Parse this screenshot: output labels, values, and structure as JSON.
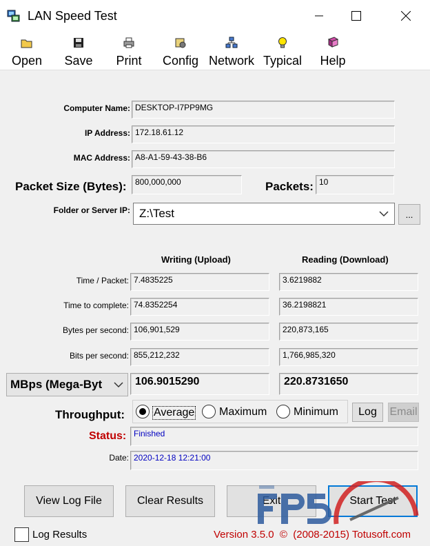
{
  "window": {
    "title": "LAN Speed Test"
  },
  "toolbar": [
    {
      "label": "Open",
      "icon": "open-folder-icon"
    },
    {
      "label": "Save",
      "icon": "floppy-disk-icon"
    },
    {
      "label": "Print",
      "icon": "printer-icon"
    },
    {
      "label": "Config",
      "icon": "config-icon"
    },
    {
      "label": "Network",
      "icon": "network-icon"
    },
    {
      "label": "Typical",
      "icon": "lightbulb-icon"
    },
    {
      "label": "Help",
      "icon": "help-book-icon"
    }
  ],
  "info": {
    "computer_name_label": "Computer Name:",
    "computer_name": "DESKTOP-I7PP9MG",
    "ip_label": "IP Address:",
    "ip": "172.18.61.12",
    "mac_label": "MAC Address:",
    "mac": "A8-A1-59-43-38-B6",
    "packet_size_label": "Packet Size (Bytes):",
    "packet_size": "800,000,000",
    "packets_label": "Packets:",
    "packets": "10",
    "folder_label": "Folder or Server IP:",
    "folder": "Z:\\Test",
    "browse_label": "..."
  },
  "results": {
    "writing_header": "Writing (Upload)",
    "reading_header": "Reading (Download)",
    "time_packet_label": "Time / Packet:",
    "time_complete_label": "Time to complete:",
    "bytes_sec_label": "Bytes per second:",
    "bits_sec_label": "Bits per second:",
    "write": {
      "time_packet": "7.4835225",
      "time_complete": "74.8352254",
      "bytes_sec": "106,901,529",
      "bits_sec": "855,212,232",
      "throughput": "106.9015290"
    },
    "read": {
      "time_packet": "3.6219882",
      "time_complete": "36.2198821",
      "bytes_sec": "220,873,165",
      "bits_sec": "1,766,985,320",
      "throughput": "220.8731650"
    },
    "unit_select": "MBps (Mega-Byt"
  },
  "throughput": {
    "label": "Throughput:",
    "options": [
      "Average",
      "Maximum",
      "Minimum"
    ],
    "selected": "Average",
    "log_button": "Log",
    "email_button": "Email"
  },
  "status": {
    "label": "Status:",
    "value": "Finished",
    "date_label": "Date:",
    "date": "2020-12-18 12:21:00"
  },
  "buttons": {
    "view_log": "View Log File",
    "clear": "Clear Results",
    "exit": "Exit",
    "start": "Start Test"
  },
  "footer": {
    "log_results": "Log Results",
    "version": "Version 3.5.0  ©  (2008-2015) Totusoft.com"
  },
  "colors": {
    "status_label": "#c00000",
    "status_value": "#0000c0",
    "version_text": "#c00000",
    "start_border": "#0078d7"
  }
}
